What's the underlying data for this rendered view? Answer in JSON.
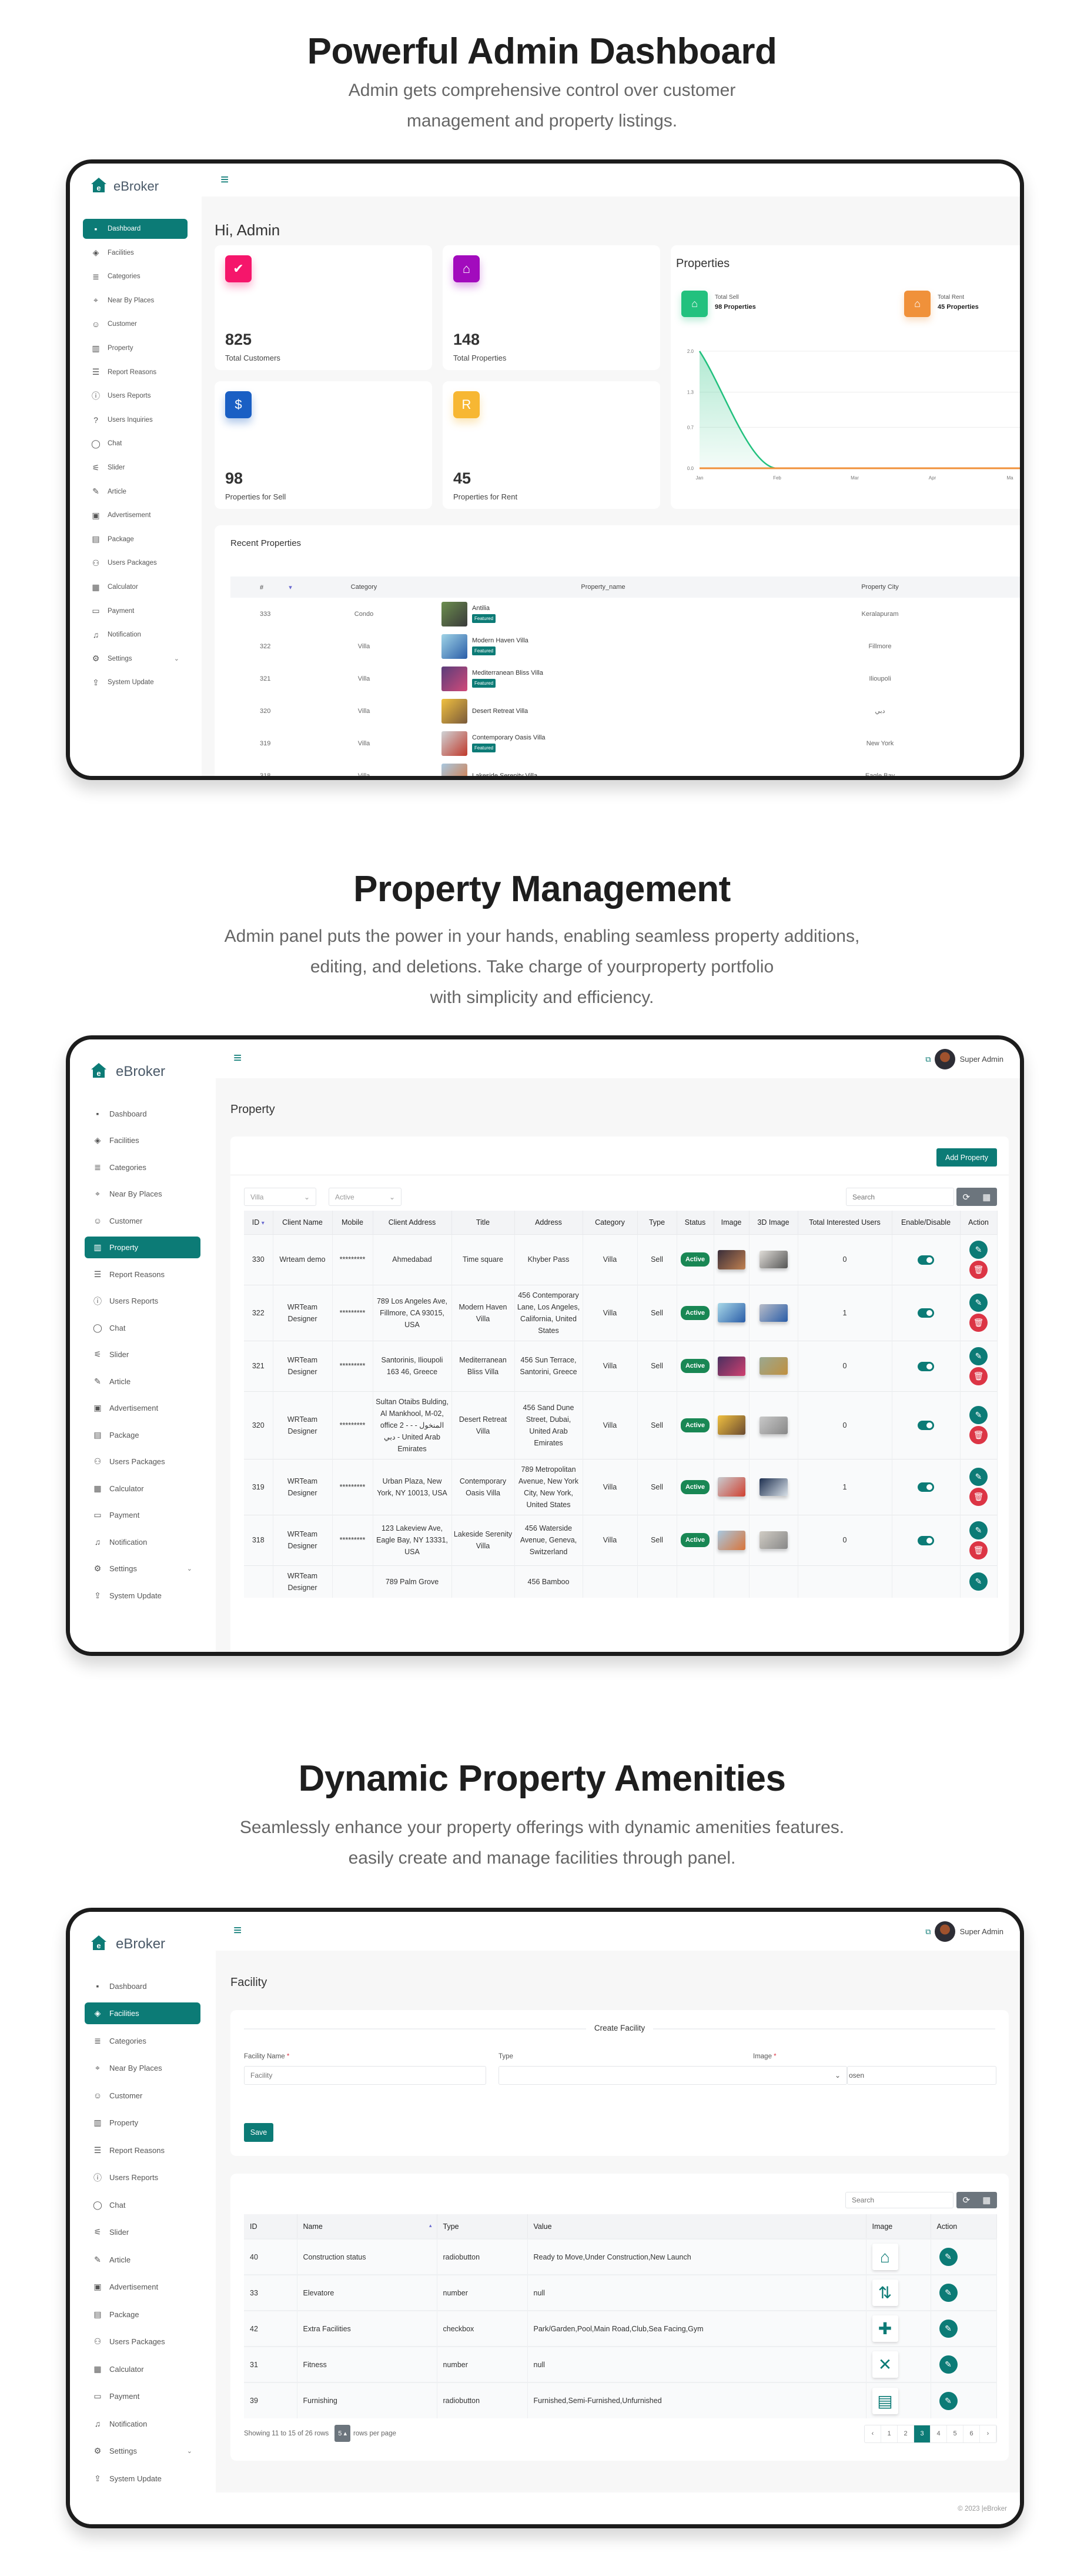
{
  "sections": [
    {
      "title": "Powerful Admin Dashboard",
      "subtitle_lines": [
        "Admin gets comprehensive control over customer",
        "management and property listings."
      ]
    },
    {
      "title": "Property Management",
      "subtitle_lines": [
        "Admin panel puts the power in your hands, enabling seamless property additions,",
        "editing, and deletions. Take charge of yourproperty portfolio",
        "with simplicity and efficiency."
      ]
    },
    {
      "title": "Dynamic Property Amenities",
      "subtitle_lines": [
        "Seamlessly enhance your property offerings with dynamic amenities features.",
        "easily create and manage facilities through panel."
      ]
    }
  ],
  "brand": "eBroker",
  "colors": {
    "primary": "#0c7b76",
    "active_badge": "#198754",
    "delete": "#dc3545",
    "sell": "#22c17e",
    "rent": "#f0913a"
  },
  "dashboard": {
    "sidebar": [
      {
        "label": "Dashboard",
        "icon": "grid"
      },
      {
        "label": "Facilities",
        "icon": "diamond"
      },
      {
        "label": "Categories",
        "icon": "list"
      },
      {
        "label": "Near By Places",
        "icon": "map-pin"
      },
      {
        "label": "Customer",
        "icon": "user-circle"
      },
      {
        "label": "Property",
        "icon": "building"
      },
      {
        "label": "Report Reasons",
        "icon": "list-bullets"
      },
      {
        "label": "Users Reports",
        "icon": "alert-circle"
      },
      {
        "label": "Users Inquiries",
        "icon": "question"
      },
      {
        "label": "Chat",
        "icon": "chat"
      },
      {
        "label": "Slider",
        "icon": "sliders"
      },
      {
        "label": "Article",
        "icon": "pen"
      },
      {
        "label": "Advertisement",
        "icon": "ad"
      },
      {
        "label": "Package",
        "icon": "package"
      },
      {
        "label": "Users Packages",
        "icon": "users"
      },
      {
        "label": "Calculator",
        "icon": "calculator"
      },
      {
        "label": "Payment",
        "icon": "payment"
      },
      {
        "label": "Notification",
        "icon": "bell"
      },
      {
        "label": "Settings",
        "icon": "gear",
        "has_chevron": true
      },
      {
        "label": "System Update",
        "icon": "update"
      }
    ],
    "active_index": 0,
    "greeting": "Hi, Admin",
    "stats": [
      {
        "value": "825",
        "label": "Total Customers",
        "icon": "user-check",
        "color": "#f5166b"
      },
      {
        "value": "148",
        "label": "Total Properties",
        "icon": "house",
        "color": "#a20bbd"
      },
      {
        "value": "98",
        "label": "Properties for Sell",
        "icon": "sale-sign",
        "color": "#1a5fc4"
      },
      {
        "value": "45",
        "label": "Properties for Rent",
        "icon": "rent-sign",
        "color": "#f7b733"
      }
    ],
    "chart_card": {
      "title": "Properties",
      "sell_label": "Total Sell",
      "sell_value": "98 Properties",
      "rent_label": "Total Rent",
      "rent_value": "45 Properties"
    },
    "recent": {
      "title": "Recent Properties",
      "columns": [
        "#",
        "Category",
        "Property_name",
        "Property City"
      ],
      "rows": [
        {
          "id": "333",
          "category": "Condo",
          "name": "Antilia",
          "featured": "Featured",
          "city": "Keralapuram",
          "thumb": [
            "#6b8e4e",
            "#3a3a3a"
          ]
        },
        {
          "id": "322",
          "category": "Villa",
          "name": "Modern Haven Villa",
          "featured": "Featured",
          "city": "Fillmore",
          "thumb": [
            "#9fd3e6",
            "#2a5da8"
          ]
        },
        {
          "id": "321",
          "category": "Villa",
          "name": "Mediterranean Bliss Villa",
          "featured": "Featured",
          "city": "Ilioupoli",
          "thumb": [
            "#5a3d7a",
            "#d14a7a"
          ]
        },
        {
          "id": "320",
          "category": "Villa",
          "name": "Desert Retreat Villa",
          "featured": "",
          "city": "دبي",
          "thumb": [
            "#f0c040",
            "#7a5a3a"
          ]
        },
        {
          "id": "319",
          "category": "Villa",
          "name": "Contemporary Oasis Villa",
          "featured": "Featured",
          "city": "New York",
          "thumb": [
            "#cfd3d6",
            "#c0392b"
          ]
        },
        {
          "id": "318",
          "category": "Villa",
          "name": "Lakeside Serenity Villa",
          "featured": "",
          "city": "Eagle Bay",
          "thumb": [
            "#a8c8e0",
            "#d9743a"
          ]
        }
      ]
    }
  },
  "chart_data": {
    "type": "area",
    "title": "",
    "categories": [
      "Jan",
      "Feb",
      "Mar",
      "Apr",
      "Ma"
    ],
    "yticks": [
      "0.0",
      "0.7",
      "1.3",
      "2.0"
    ],
    "ylim": [
      0,
      2
    ],
    "grid": true,
    "series": [
      {
        "values": [
          2,
          0,
          0,
          0,
          0
        ],
        "color": "#22c17e",
        "fill": true
      },
      {
        "values": [
          0,
          0,
          0,
          0,
          0
        ],
        "color": "#f0913a",
        "fill": false
      }
    ]
  },
  "admin_sidebar": [
    {
      "label": "Dashboard",
      "icon": "grid"
    },
    {
      "label": "Facilities",
      "icon": "diamond"
    },
    {
      "label": "Categories",
      "icon": "list"
    },
    {
      "label": "Near By Places",
      "icon": "map-pin"
    },
    {
      "label": "Customer",
      "icon": "user-circle"
    },
    {
      "label": "Property",
      "icon": "building"
    },
    {
      "label": "Report Reasons",
      "icon": "list-bullets"
    },
    {
      "label": "Users Reports",
      "icon": "alert-circle"
    },
    {
      "label": "Chat",
      "icon": "chat"
    },
    {
      "label": "Slider",
      "icon": "sliders"
    },
    {
      "label": "Article",
      "icon": "pen"
    },
    {
      "label": "Advertisement",
      "icon": "ad"
    },
    {
      "label": "Package",
      "icon": "package"
    },
    {
      "label": "Users Packages",
      "icon": "users"
    },
    {
      "label": "Calculator",
      "icon": "calculator"
    },
    {
      "label": "Payment",
      "icon": "payment"
    },
    {
      "label": "Notification",
      "icon": "bell"
    },
    {
      "label": "Settings",
      "icon": "gear",
      "has_chevron": true
    },
    {
      "label": "System Update",
      "icon": "update"
    }
  ],
  "user_name": "Super Admin",
  "property_page": {
    "active_index": 5,
    "title": "Property",
    "add_button": "Add Property",
    "filter_category": "Villa",
    "filter_status": "Active",
    "search_placeholder": "Search",
    "columns": [
      "ID",
      "Client Name",
      "Mobile",
      "Client Address",
      "Title",
      "Address",
      "Category",
      "Type",
      "Status",
      "Image",
      "3D Image",
      "Total Interested Users",
      "Enable/Disable",
      "Action"
    ],
    "rows": [
      {
        "id": "330",
        "client": "Wrteam demo",
        "mobile": "*********",
        "client_address": "Ahmedabad",
        "title": "Time square",
        "address": "Khyber Pass",
        "category": "Villa",
        "type": "Sell",
        "status": "Active",
        "interested": "0",
        "img": [
          "#3a2e3a",
          "#c08050"
        ],
        "img3d": [
          "#e0ddd8",
          "#555"
        ]
      },
      {
        "id": "322",
        "client": "WRTeam Designer",
        "mobile": "*********",
        "client_address": "789 Los Angeles Ave, Fillmore, CA 93015, USA",
        "title": "Modern Haven Villa",
        "address": "456 Contemporary Lane, Los Angeles, California, United States",
        "category": "Villa",
        "type": "Sell",
        "status": "Active",
        "interested": "1",
        "img": [
          "#a8d8e8",
          "#2a5da8"
        ],
        "img3d": [
          "#b8bcc8",
          "#2a5da8"
        ]
      },
      {
        "id": "321",
        "client": "WRTeam Designer",
        "mobile": "*********",
        "client_address": "Santorinis, Ilioupoli 163 46, Greece",
        "title": "Mediterranean Bliss Villa",
        "address": "456 Sun Terrace, Santorini, Greece",
        "category": "Villa",
        "type": "Sell",
        "status": "Active",
        "interested": "0",
        "img": [
          "#4a3060",
          "#d04070"
        ],
        "img3d": [
          "#9aa890",
          "#c09040"
        ]
      },
      {
        "id": "320",
        "client": "WRTeam Designer",
        "mobile": "*********",
        "client_address": "Sultan Otaibs Bulding, Al Mankhool, M-02, office 2 - - المنخول - دبي - United Arab Emirates",
        "title": "Desert Retreat Villa",
        "address": "456 Sand Dune Street, Dubai, United Arab Emirates",
        "category": "Villa",
        "type": "Sell",
        "status": "Active",
        "interested": "0",
        "img": [
          "#f0c040",
          "#6a4a30"
        ],
        "img3d": [
          "#c8c8c8",
          "#888"
        ]
      },
      {
        "id": "319",
        "client": "WRTeam Designer",
        "mobile": "*********",
        "client_address": "Urban Plaza, New York, NY 10013, USA",
        "title": "Contemporary Oasis Villa",
        "address": "789 Metropolitan Avenue, New York City, New York, United States",
        "category": "Villa",
        "type": "Sell",
        "status": "Active",
        "interested": "1",
        "img": [
          "#c8ccd0",
          "#d04030"
        ],
        "img3d": [
          "#1e3050",
          "#d8e0e8"
        ]
      },
      {
        "id": "318",
        "client": "WRTeam Designer",
        "mobile": "*********",
        "client_address": "123 Lakeview Ave, Eagle Bay, NY 13331, USA",
        "title": "Lakeside Serenity Villa",
        "address": "456 Waterside Avenue, Geneva, Switzerland",
        "category": "Villa",
        "type": "Sell",
        "status": "Active",
        "interested": "0",
        "img": [
          "#a8c8e0",
          "#d9743a"
        ],
        "img3d": [
          "#d0ccc4",
          "#888"
        ]
      },
      {
        "id": "",
        "client": "WRTeam Designer",
        "mobile": "",
        "client_address": "789 Palm Grove",
        "title": "",
        "address": "456 Bamboo",
        "category": "",
        "type": "",
        "status": "",
        "interested": "",
        "img": null,
        "img3d": null
      }
    ]
  },
  "facility_page": {
    "active_index": 1,
    "title": "Facility",
    "form_title": "Create Facility",
    "name_label": "Facility Name",
    "name_placeholder": "Facility",
    "type_label": "Type",
    "image_label": "Image",
    "required_mark": "*",
    "file_text": "osen",
    "save_button": "Save",
    "search_placeholder": "Search",
    "columns": [
      "ID",
      "Name",
      "Type",
      "Value",
      "Image",
      "Action"
    ],
    "rows": [
      {
        "id": "40",
        "name": "Construction status",
        "type": "radiobutton",
        "value": "Ready to Move,Under Construction,New Launch",
        "icon": "construction"
      },
      {
        "id": "33",
        "name": "Elevatore",
        "type": "number",
        "value": "null",
        "icon": "elevator"
      },
      {
        "id": "42",
        "name": "Extra Facilities",
        "type": "checkbox",
        "value": "Park/Garden,Pool,Main Road,Club,Sea Facing,Gym",
        "icon": "facilities"
      },
      {
        "id": "31",
        "name": "Fitness",
        "type": "number",
        "value": "null",
        "icon": "dumbbell"
      },
      {
        "id": "39",
        "name": "Furnishing",
        "type": "radiobutton",
        "value": "Furnished,Semi-Furnished,Unfurnished",
        "icon": "furniture"
      }
    ],
    "showing": "Showing 11 to 15 of 26 rows",
    "page_size": "5",
    "rows_per_page": "rows per page",
    "pages": [
      "‹",
      "1",
      "2",
      "3",
      "4",
      "5",
      "6",
      "›"
    ],
    "active_page": "3",
    "footer": "© 2023 |eBroker"
  }
}
